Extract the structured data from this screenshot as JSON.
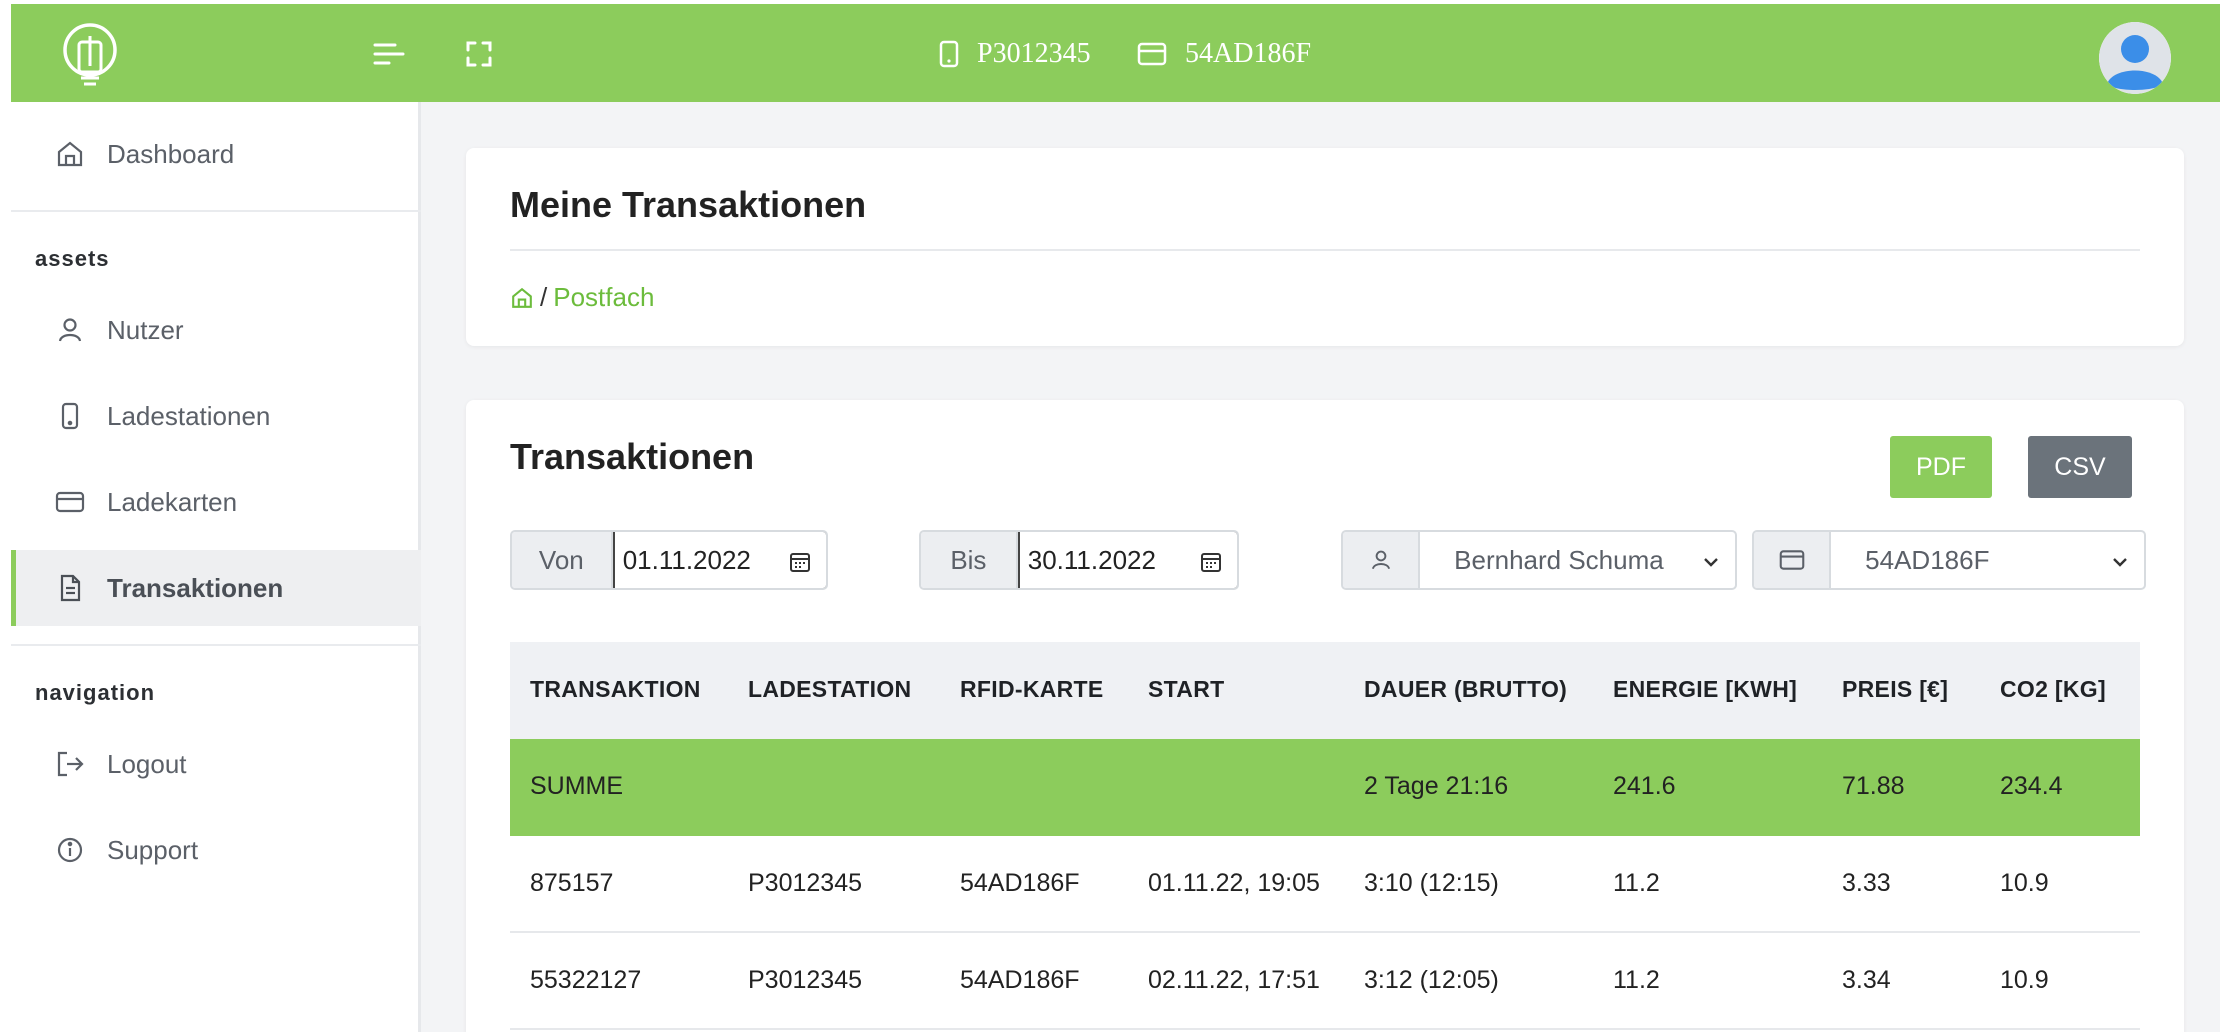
{
  "topbar": {
    "station_id": "P3012345",
    "card_id": "54AD186F",
    "brand_color": "#8ccc5c"
  },
  "sidebar": {
    "dashboard": "Dashboard",
    "section_assets": "assets",
    "nutzer": "Nutzer",
    "ladestationen": "Ladestationen",
    "ladekarten": "Ladekarten",
    "transaktionen": "Transaktionen",
    "section_navigation": "navigation",
    "logout": "Logout",
    "support": "Support"
  },
  "header_card": {
    "title": "Meine Transaktionen",
    "breadcrumb_current": "Postfach",
    "breadcrumb_sep": "/"
  },
  "transactions": {
    "title": "Transaktionen",
    "pdf_label": "PDF",
    "csv_label": "CSV",
    "von_label": "Von",
    "von_value": "01.11.2022",
    "bis_label": "Bis",
    "bis_value": "30.11.2022",
    "user_selected": "Bernhard Schuma",
    "card_selected": "54AD186F"
  },
  "table": {
    "headers": [
      "TRANSAKTION",
      "LADESTATION",
      "RFID-KARTE",
      "START",
      "DAUER (BRUTTO)",
      "ENERGIE [KWH]",
      "PREIS [€]",
      "CO2 [KG]"
    ],
    "summary": [
      "SUMME",
      "",
      "",
      "",
      "2 Tage 21:16",
      "241.6",
      "71.88",
      "234.4"
    ],
    "rows": [
      [
        "875157",
        "P3012345",
        "54AD186F",
        "01.11.22, 19:05",
        "3:10 (12:15)",
        "11.2",
        "3.33",
        "10.9"
      ],
      [
        "55322127",
        "P3012345",
        "54AD186F",
        "02.11.22, 17:51",
        "3:12 (12:05)",
        "11.2",
        "3.34",
        "10.9"
      ]
    ]
  }
}
